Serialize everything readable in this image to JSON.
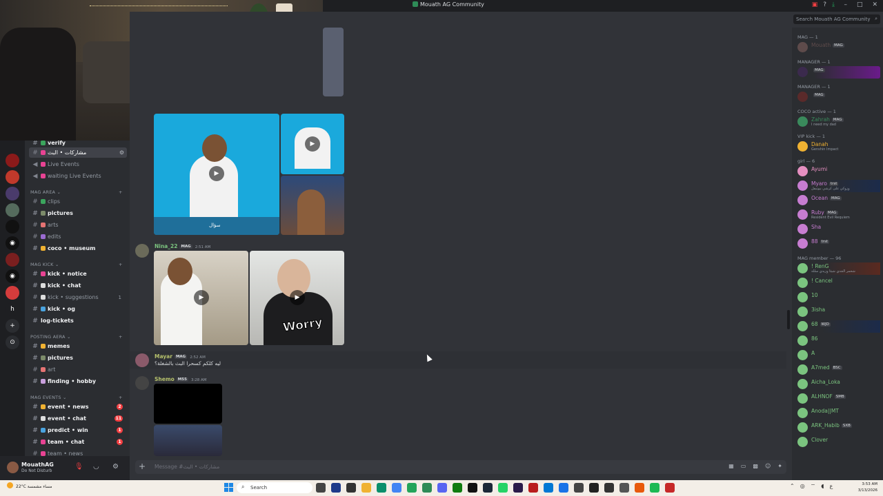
{
  "window": {
    "title": "Mouath AG Community"
  },
  "search": {
    "placeholder": "Search Mouath AG Community"
  },
  "sidebar": {
    "channels": [
      {
        "id": "ch-verify",
        "label": "verify",
        "bold": true
      },
      {
        "id": "ch-active",
        "label": "مشاركات • البث",
        "active": true
      },
      {
        "id": "ch-live-events",
        "label": "Live Events"
      },
      {
        "id": "ch-waiting-live",
        "label": "waiting Live Events"
      }
    ],
    "categories": [
      {
        "label": "MAG AREA",
        "items": [
          {
            "label": "clips",
            "bold": false
          },
          {
            "label": "pictures",
            "bold": true
          },
          {
            "label": "arts",
            "bold": false
          },
          {
            "label": "edits",
            "bold": false
          },
          {
            "label": "coco • museum",
            "bold": true
          }
        ]
      },
      {
        "label": "MAG KICK",
        "items": [
          {
            "label": "kick • notice",
            "bold": true
          },
          {
            "label": "kick • chat",
            "bold": true
          },
          {
            "label": "kick • suggestions",
            "bold": false,
            "count": "1"
          },
          {
            "label": "kick • og",
            "bold": true
          },
          {
            "label": "log-tickets",
            "bold": true
          }
        ]
      },
      {
        "label": "POSTING AERA",
        "items": [
          {
            "label": "memes",
            "bold": true
          },
          {
            "label": "pictures",
            "bold": true
          },
          {
            "label": "art",
            "bold": false
          },
          {
            "label": "finding • hobby",
            "bold": true
          }
        ]
      },
      {
        "label": "MAG EVENTS",
        "items": [
          {
            "label": "event • news",
            "bold": true,
            "badge": "2"
          },
          {
            "label": "event • chat",
            "bold": true,
            "badge": "11"
          },
          {
            "label": "predict • win",
            "bold": true,
            "badge": "1"
          },
          {
            "label": "team • chat",
            "bold": true,
            "badge": "1"
          },
          {
            "label": "team • news",
            "bold": false
          }
        ]
      }
    ]
  },
  "user": {
    "name": "MouathAG",
    "status": "Do Not Disturb"
  },
  "messages": [
    {
      "author": "Nina_22",
      "tag": "MAG",
      "time": "2:51 AM",
      "color": "#7bc47f"
    },
    {
      "author": "Mayar",
      "tag": "MAG",
      "time": "2:52 AM",
      "text": "ليه كلكم كسحرا البث بالشغلة؟",
      "color": "#b6c16c"
    },
    {
      "author": "Shemo",
      "tag": "M55",
      "time": "3:28 AM",
      "color": "#b6c16c"
    }
  ],
  "media_captions": {
    "video_caption": "سؤال",
    "worry": "Worry"
  },
  "composer": {
    "placeholder": "Message #مشاركات • البث"
  },
  "members": {
    "groups": [
      {
        "label": "MAG — 1",
        "members": [
          {
            "name": "Mouath",
            "tag": "MAG",
            "color": "#5e4b4b"
          }
        ]
      },
      {
        "label": "MANAGER — 1",
        "members": [
          {
            "name": "",
            "tag": "MAG",
            "sub": "",
            "color": "#3b2a4d",
            "boost": "boost"
          }
        ]
      },
      {
        "label": "MANAGER — 1",
        "members": [
          {
            "name": "",
            "tag": "MAG",
            "color": "#5a2a2a"
          }
        ]
      },
      {
        "label": "COCO active — 1",
        "members": [
          {
            "name": "Zahrah",
            "tag": "MAG",
            "sub": "I need my dad",
            "color": "#3a8a5c"
          }
        ]
      },
      {
        "label": "VIP kick — 1",
        "members": [
          {
            "name": "Danah",
            "sub": "Genshin Impact",
            "color": "#f0b232"
          }
        ]
      },
      {
        "label": "girl — 6",
        "members": [
          {
            "name": "Ayumi",
            "color": "#e58fc0"
          },
          {
            "name": "Myaro",
            "tag": "trst",
            "sub": "وزوكي على كرشي بيوتيفل",
            "color": "#c77dd1",
            "boost": "boost2"
          },
          {
            "name": "Ocean",
            "tag": "MAG",
            "color": "#c77dd1"
          },
          {
            "name": "Ruby",
            "tag": "MAG",
            "sub": "Resident Evil Requiem",
            "color": "#c77dd1"
          },
          {
            "name": "Sha",
            "color": "#c77dd1"
          },
          {
            "name": "88",
            "tag": "trst",
            "color": "#c77dd1"
          }
        ]
      },
      {
        "label": "MAG member — 96",
        "members": [
          {
            "name": "! RenG",
            "sub": "شحمر الجدي شيئا وزيدي سللة",
            "color": "#7bc47f",
            "boost": "boost3"
          },
          {
            "name": "! Cancel",
            "color": "#7bc47f"
          },
          {
            "name": "10",
            "color": "#7bc47f"
          },
          {
            "name": "3isha",
            "color": "#7bc47f"
          },
          {
            "name": "68",
            "tag": "WJD",
            "sub": "",
            "color": "#7bc47f",
            "boost": "boost2"
          },
          {
            "name": "86",
            "color": "#7bc47f"
          },
          {
            "name": "A",
            "color": "#7bc47f"
          },
          {
            "name": "A7med",
            "tag": "BSC",
            "color": "#7bc47f"
          },
          {
            "name": "Aicha_Loka",
            "color": "#7bc47f"
          },
          {
            "name": "ALHNOF",
            "tag": "SMB",
            "color": "#7bc47f"
          },
          {
            "name": "Anoda||MT",
            "color": "#7bc47f"
          },
          {
            "name": "ARK_Habib",
            "tag": "SXB",
            "color": "#7bc47f"
          },
          {
            "name": "Clover",
            "color": "#7bc47f"
          }
        ]
      }
    ]
  },
  "taskbar": {
    "weather_temp": "22°C",
    "weather_desc": "مساء مشمسة",
    "search": "Search",
    "time": "3:53 AM",
    "date": "3/13/2026"
  }
}
